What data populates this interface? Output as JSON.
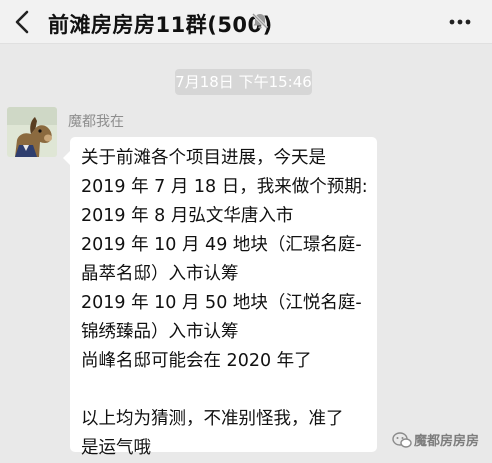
{
  "header": {
    "title": "前滩房房房11群(500)",
    "back_icon": "back-arrow-icon",
    "mute_icon": "bell-muted-icon",
    "more_icon": "more-dots-icon"
  },
  "chat": {
    "timestamp": "7月18日 下午15:46",
    "messages": [
      {
        "sender": "魔都我在",
        "avatar_icon": "horse-avatar",
        "lines": [
          "关于前滩各个项目进展，今天是",
          "2019 年 7 月 18 日，我来做个预期:",
          "2019 年 8 月弘文华唐入市",
          "2019 年 10 月 49 地块（汇璟名庭-",
          "晶萃名邸）入市认筹",
          "2019 年 10 月 50 地块（江悦名庭-",
          "锦绣臻品）入市认筹",
          "尚峰名邸可能会在 2020 年了",
          "",
          "以上均为猜测，不准别怪我，准了",
          "是运气哦"
        ]
      }
    ]
  },
  "watermark": {
    "text": "魔都房房房",
    "icon": "wechat-official-account-icon"
  },
  "colors": {
    "background": "#e9e9e9",
    "header": "#f2f2f2",
    "bubble": "#ffffff",
    "timestamp_bg": "#d6d6d6"
  }
}
